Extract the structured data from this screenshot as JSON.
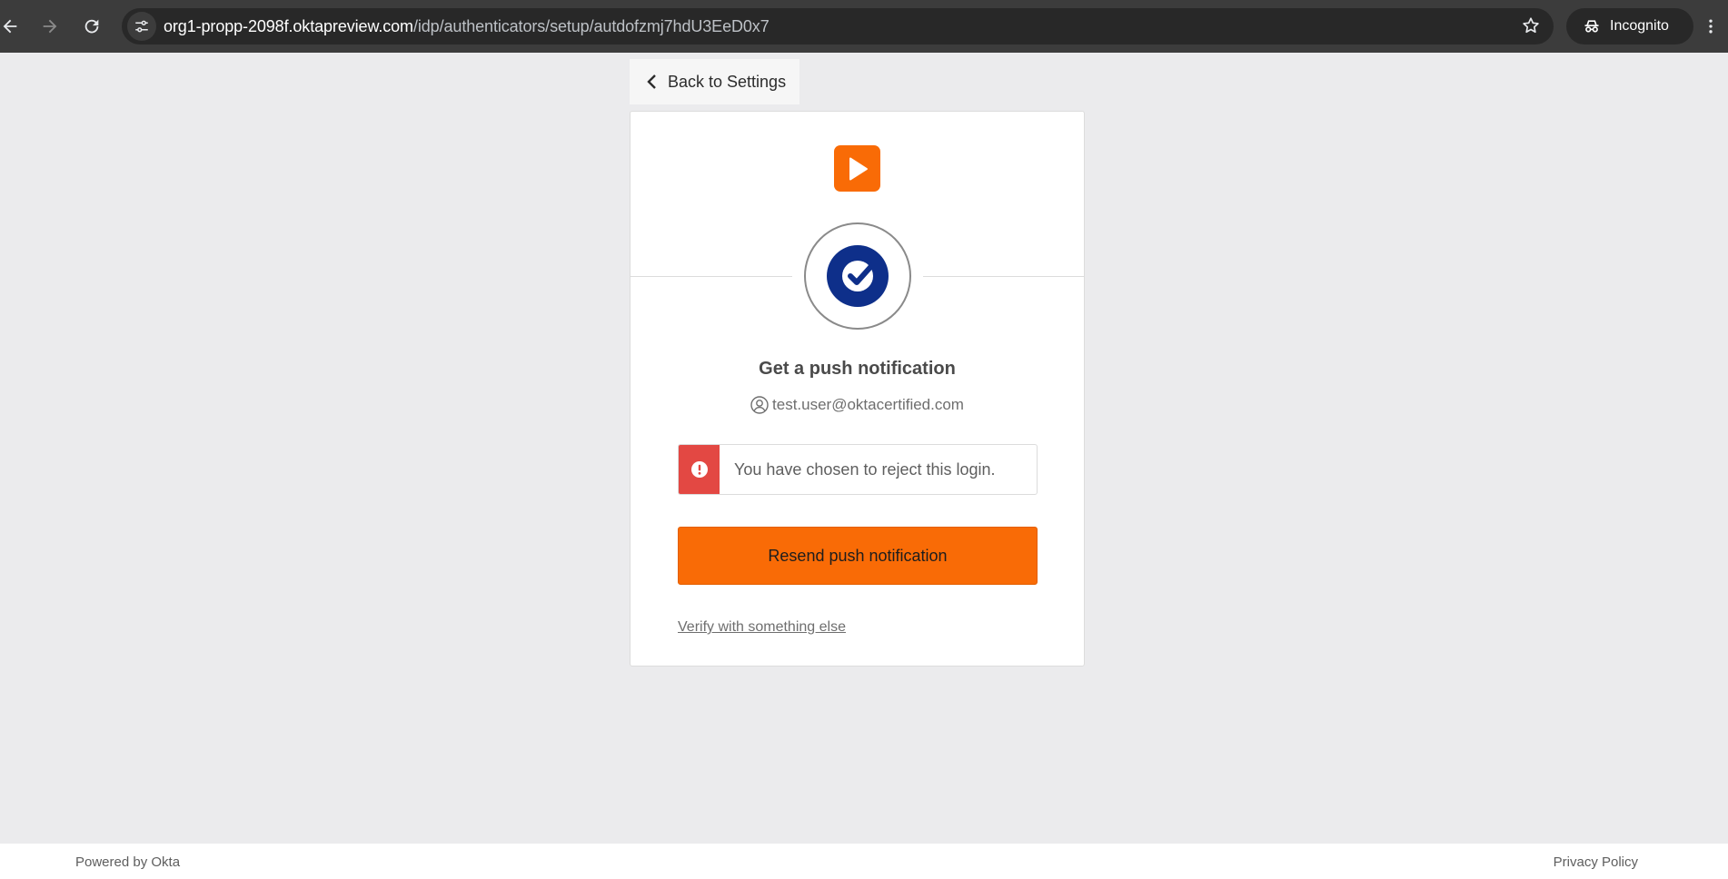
{
  "browser": {
    "url_host": "org1-propp-2098f.oktapreview.com",
    "url_path": "/idp/authenticators/setup/autdofzmj7hdU3EeD0x7",
    "incognito_label": "Incognito",
    "icons": {
      "back": "arrow-left-icon",
      "forward": "arrow-right-icon",
      "reload": "reload-icon",
      "site_info": "tune-icon",
      "bookmark": "star-icon",
      "incognito": "incognito-icon",
      "menu": "more-vert-icon"
    }
  },
  "page": {
    "back_link_label": "Back to Settings",
    "card": {
      "title": "Get a push notification",
      "identifier": "test.user@oktacertified.com",
      "alert_message": "You have chosen to reject this login.",
      "resend_button_label": "Resend push notification",
      "verify_other_link": "Verify with something else"
    }
  },
  "footer": {
    "powered_by": "Powered by Okta",
    "privacy_policy": "Privacy Policy"
  },
  "colors": {
    "brand_orange": "#f96b06",
    "okta_verify_blue": "#0e2f8a",
    "error_red": "#e34843",
    "page_background": "#ebebed"
  }
}
